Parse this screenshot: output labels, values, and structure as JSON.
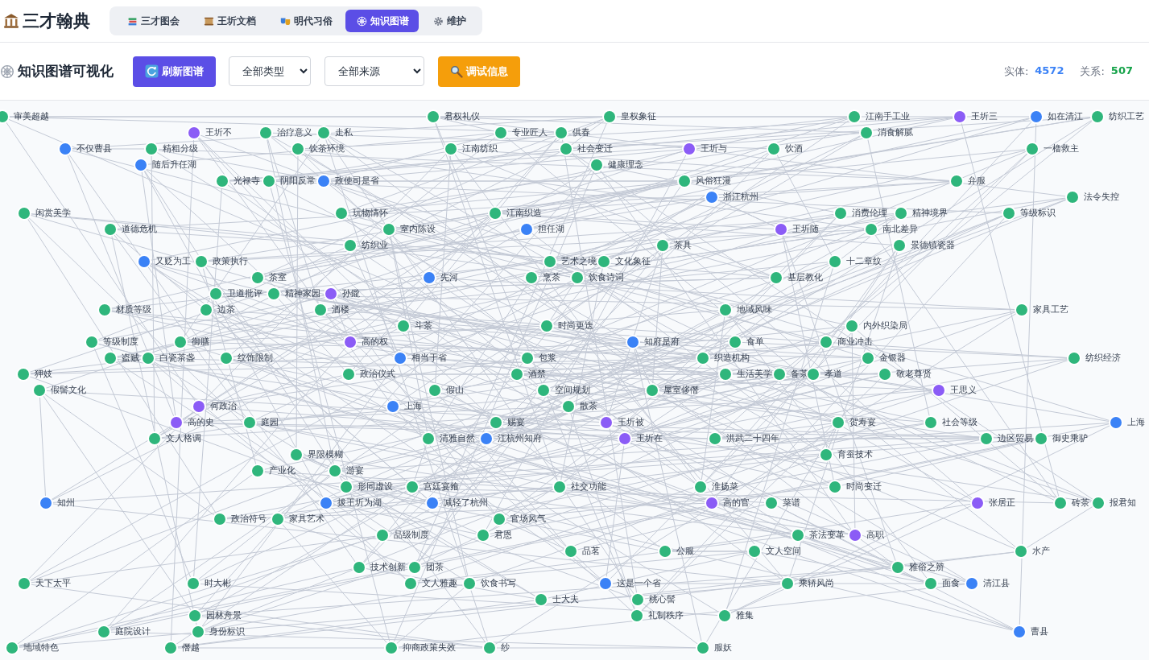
{
  "app": {
    "title": "三才翰典"
  },
  "tabs": [
    {
      "label": "三才图会",
      "selected": false
    },
    {
      "label": "王圻文档",
      "selected": false
    },
    {
      "label": "明代习俗",
      "selected": false
    },
    {
      "label": "知识图谱",
      "selected": true
    },
    {
      "label": "维护",
      "selected": false
    }
  ],
  "toolbar": {
    "title": "知识图谱可视化",
    "refresh_button": "刷新图谱",
    "type_filter": "全部类型",
    "source_filter": "全部来源",
    "debug_button": "调试信息",
    "stats": [
      {
        "label": "实体:",
        "value": "4572",
        "kind": "entity"
      },
      {
        "label": "关系:",
        "value": "507",
        "kind": "relation"
      }
    ]
  },
  "graph": {
    "nodes": [
      {
        "label": "审美超越",
        "kind": "concept"
      },
      {
        "label": "君权礼仪",
        "kind": "concept"
      },
      {
        "label": "皇权象征",
        "kind": "concept"
      },
      {
        "label": "江南手工业",
        "kind": "concept"
      },
      {
        "label": "王圻三",
        "kind": "person"
      },
      {
        "label": "如在清江",
        "kind": "place"
      },
      {
        "label": "纺织工艺",
        "kind": "concept"
      },
      {
        "label": "王圻不",
        "kind": "person"
      },
      {
        "label": "治疗意义",
        "kind": "concept"
      },
      {
        "label": "走私",
        "kind": "concept"
      },
      {
        "label": "专业匠人",
        "kind": "concept"
      },
      {
        "label": "供春",
        "kind": "concept"
      },
      {
        "label": "消食解腻",
        "kind": "concept"
      },
      {
        "label": "不仅曹县",
        "kind": "place"
      },
      {
        "label": "精粗分级",
        "kind": "concept"
      },
      {
        "label": "饮茶环境",
        "kind": "concept"
      },
      {
        "label": "江南纺织",
        "kind": "concept"
      },
      {
        "label": "社会变迁",
        "kind": "concept"
      },
      {
        "label": "王圻与",
        "kind": "person"
      },
      {
        "label": "饮酒",
        "kind": "concept"
      },
      {
        "label": "一橹救主",
        "kind": "concept"
      },
      {
        "label": "随后升任湖",
        "kind": "place"
      },
      {
        "label": "健康理念",
        "kind": "concept"
      },
      {
        "label": "光禄寺",
        "kind": "concept"
      },
      {
        "label": "阴阳反常",
        "kind": "concept"
      },
      {
        "label": "政使司是省",
        "kind": "place"
      },
      {
        "label": "风俗狂漫",
        "kind": "concept"
      },
      {
        "label": "弁服",
        "kind": "concept"
      },
      {
        "label": "浙江杭州",
        "kind": "place"
      },
      {
        "label": "法令失控",
        "kind": "concept"
      },
      {
        "label": "闲赏美学",
        "kind": "concept"
      },
      {
        "label": "玩物情怀",
        "kind": "concept"
      },
      {
        "label": "江南织造",
        "kind": "concept"
      },
      {
        "label": "消费伦理",
        "kind": "concept"
      },
      {
        "label": "精神境界",
        "kind": "concept"
      },
      {
        "label": "等级标识",
        "kind": "concept"
      },
      {
        "label": "道德危机",
        "kind": "concept"
      },
      {
        "label": "室内陈设",
        "kind": "concept"
      },
      {
        "label": "担任湖",
        "kind": "place"
      },
      {
        "label": "王圻随",
        "kind": "person"
      },
      {
        "label": "南北差异",
        "kind": "concept"
      },
      {
        "label": "纺织业",
        "kind": "concept"
      },
      {
        "label": "茶具",
        "kind": "concept"
      },
      {
        "label": "景德镇瓷器",
        "kind": "concept"
      },
      {
        "label": "又贬为工",
        "kind": "place"
      },
      {
        "label": "政策执行",
        "kind": "concept"
      },
      {
        "label": "艺术之境",
        "kind": "concept"
      },
      {
        "label": "文化象征",
        "kind": "concept"
      },
      {
        "label": "十二章纹",
        "kind": "concept"
      },
      {
        "label": "茶室",
        "kind": "concept"
      },
      {
        "label": "先河",
        "kind": "place"
      },
      {
        "label": "烹茶",
        "kind": "concept"
      },
      {
        "label": "饮食诗词",
        "kind": "concept"
      },
      {
        "label": "基层教化",
        "kind": "concept"
      },
      {
        "label": "卫道批评",
        "kind": "concept"
      },
      {
        "label": "精神家园",
        "kind": "concept"
      },
      {
        "label": "孙鑨",
        "kind": "person"
      },
      {
        "label": "材质等级",
        "kind": "concept"
      },
      {
        "label": "边茶",
        "kind": "concept"
      },
      {
        "label": "酒楼",
        "kind": "concept"
      },
      {
        "label": "地域风味",
        "kind": "concept"
      },
      {
        "label": "家具工艺",
        "kind": "concept"
      },
      {
        "label": "斗茶",
        "kind": "concept"
      },
      {
        "label": "时尚更迭",
        "kind": "concept"
      },
      {
        "label": "内外织染局",
        "kind": "concept"
      },
      {
        "label": "等级制度",
        "kind": "concept"
      },
      {
        "label": "御膳",
        "kind": "concept"
      },
      {
        "label": "高的权",
        "kind": "person"
      },
      {
        "label": "知府是府",
        "kind": "place"
      },
      {
        "label": "食单",
        "kind": "concept"
      },
      {
        "label": "商业冲击",
        "kind": "concept"
      },
      {
        "label": "盗贼",
        "kind": "concept"
      },
      {
        "label": "白瓷茶盏",
        "kind": "concept"
      },
      {
        "label": "纹饰限制",
        "kind": "concept"
      },
      {
        "label": "相当于省",
        "kind": "place"
      },
      {
        "label": "包浆",
        "kind": "concept"
      },
      {
        "label": "织造机构",
        "kind": "concept"
      },
      {
        "label": "金银器",
        "kind": "concept"
      },
      {
        "label": "纺织经济",
        "kind": "concept"
      },
      {
        "label": "狎妓",
        "kind": "concept"
      },
      {
        "label": "政治仪式",
        "kind": "concept"
      },
      {
        "label": "酒禁",
        "kind": "concept"
      },
      {
        "label": "生活美学",
        "kind": "concept"
      },
      {
        "label": "备茶",
        "kind": "concept"
      },
      {
        "label": "孝道",
        "kind": "concept"
      },
      {
        "label": "敬老尊贤",
        "kind": "concept"
      },
      {
        "label": "假髻文化",
        "kind": "concept"
      },
      {
        "label": "假山",
        "kind": "concept"
      },
      {
        "label": "空间规划",
        "kind": "concept"
      },
      {
        "label": "屋室侈僭",
        "kind": "concept"
      },
      {
        "label": "王思义",
        "kind": "person"
      },
      {
        "label": "何政治",
        "kind": "person"
      },
      {
        "label": "上海",
        "kind": "place"
      },
      {
        "label": "散茶",
        "kind": "concept"
      },
      {
        "label": "高的史",
        "kind": "person"
      },
      {
        "label": "庭园",
        "kind": "concept"
      },
      {
        "label": "赐宴",
        "kind": "concept"
      },
      {
        "label": "王圻被",
        "kind": "person"
      },
      {
        "label": "贺寿宴",
        "kind": "concept"
      },
      {
        "label": "社会等级",
        "kind": "concept"
      },
      {
        "label": "上海",
        "kind": "place"
      },
      {
        "label": "文人格调",
        "kind": "concept"
      },
      {
        "label": "清雅自然",
        "kind": "concept"
      },
      {
        "label": "江杭州知府",
        "kind": "place"
      },
      {
        "label": "王圻在",
        "kind": "person"
      },
      {
        "label": "洪武二十四年",
        "kind": "concept"
      },
      {
        "label": "边区贸易",
        "kind": "concept"
      },
      {
        "label": "御史乘驴",
        "kind": "concept"
      },
      {
        "label": "界限模糊",
        "kind": "concept"
      },
      {
        "label": "育蚕技术",
        "kind": "concept"
      },
      {
        "label": "产业化",
        "kind": "concept"
      },
      {
        "label": "游宴",
        "kind": "concept"
      },
      {
        "label": "形同虚设",
        "kind": "concept"
      },
      {
        "label": "宫廷宴飨",
        "kind": "concept"
      },
      {
        "label": "社交功能",
        "kind": "concept"
      },
      {
        "label": "淮扬菜",
        "kind": "concept"
      },
      {
        "label": "时尚变迁",
        "kind": "concept"
      },
      {
        "label": "知州",
        "kind": "place"
      },
      {
        "label": "拔王圻为湖",
        "kind": "place"
      },
      {
        "label": "减轻了杭州",
        "kind": "place"
      },
      {
        "label": "高的官",
        "kind": "person"
      },
      {
        "label": "菜谱",
        "kind": "concept"
      },
      {
        "label": "张居正",
        "kind": "person"
      },
      {
        "label": "砖茶",
        "kind": "concept"
      },
      {
        "label": "报君知",
        "kind": "concept"
      },
      {
        "label": "政治符号",
        "kind": "concept"
      },
      {
        "label": "家具艺术",
        "kind": "concept"
      },
      {
        "label": "官场风气",
        "kind": "concept"
      },
      {
        "label": "品级制度",
        "kind": "concept"
      },
      {
        "label": "君恩",
        "kind": "concept"
      },
      {
        "label": "茶法变革",
        "kind": "concept"
      },
      {
        "label": "高职",
        "kind": "person"
      },
      {
        "label": "品茗",
        "kind": "concept"
      },
      {
        "label": "公服",
        "kind": "concept"
      },
      {
        "label": "文人空间",
        "kind": "concept"
      },
      {
        "label": "水产",
        "kind": "concept"
      },
      {
        "label": "技术创新",
        "kind": "concept"
      },
      {
        "label": "团茶",
        "kind": "concept"
      },
      {
        "label": "雅俗之辨",
        "kind": "concept"
      },
      {
        "label": "天下太平",
        "kind": "concept"
      },
      {
        "label": "时大彬",
        "kind": "concept"
      },
      {
        "label": "文人雅趣",
        "kind": "concept"
      },
      {
        "label": "饮食书写",
        "kind": "concept"
      },
      {
        "label": "这是一个省",
        "kind": "place"
      },
      {
        "label": "乘轿风尚",
        "kind": "concept"
      },
      {
        "label": "面食",
        "kind": "concept"
      },
      {
        "label": "清江县",
        "kind": "place"
      },
      {
        "label": "士大夫",
        "kind": "concept"
      },
      {
        "label": "桃心髻",
        "kind": "concept"
      },
      {
        "label": "园林舟景",
        "kind": "concept"
      },
      {
        "label": "礼制秩序",
        "kind": "concept"
      },
      {
        "label": "雅集",
        "kind": "concept"
      },
      {
        "label": "庭院设计",
        "kind": "concept"
      },
      {
        "label": "身份标识",
        "kind": "concept"
      },
      {
        "label": "曹县",
        "kind": "place"
      },
      {
        "label": "地域特色",
        "kind": "concept"
      },
      {
        "label": "僭越",
        "kind": "concept"
      },
      {
        "label": "抑商政策失效",
        "kind": "concept"
      },
      {
        "label": "纱",
        "kind": "concept"
      },
      {
        "label": "服妖",
        "kind": "concept"
      }
    ]
  }
}
